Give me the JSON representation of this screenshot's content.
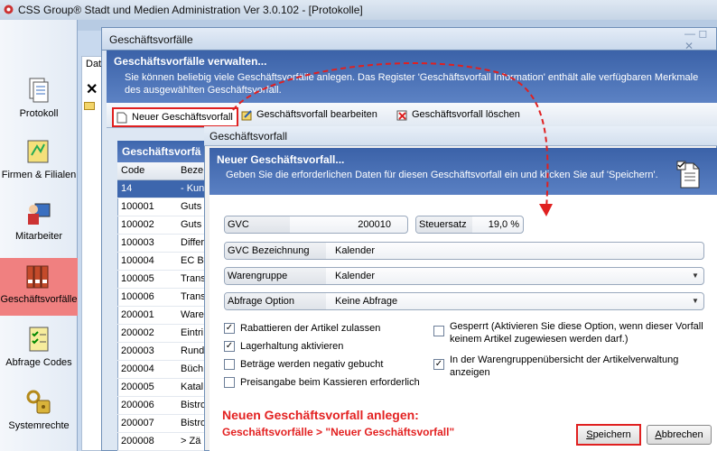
{
  "app": {
    "title": "CSS Group® Stadt und Medien Administration Ver 3.0.102 - [Protokolle]"
  },
  "nav": {
    "items": [
      {
        "label": "Protokoll",
        "icon": "protocol-icon"
      },
      {
        "label": "Firmen & Filialen",
        "icon": "companies-icon"
      },
      {
        "label": "Mitarbeiter",
        "icon": "employee-icon"
      },
      {
        "label": "Geschäftsvorfälle",
        "icon": "binders-icon",
        "active": true
      },
      {
        "label": "Abfrage Codes",
        "icon": "checklist-icon"
      },
      {
        "label": "Systemrechte",
        "icon": "keys-lock-icon"
      }
    ]
  },
  "back_window": {
    "partial_tab": "Dat"
  },
  "gv_window": {
    "title": "Geschäftsvorfälle",
    "header_title": "Geschäftsvorfälle verwalten...",
    "header_desc": "Sie können beliebig viele Geschäftsvorfälle anlegen. Das Register 'Geschäftsvorfall Information' enthält alle verfügbaren Merkmale des ausgewählten Geschäftsvorfall.",
    "toolbar": {
      "new": "Neuer Geschäftsvorfall",
      "edit": "Geschäftsvorfall bearbeiten",
      "delete": "Geschäftsvorfall löschen"
    },
    "grid": {
      "title": "Geschäftsvorfä",
      "columns": [
        "Code",
        "Beze"
      ],
      "rows": [
        {
          "code": "14",
          "name": "- Kun",
          "selected": true
        },
        {
          "code": "100001",
          "name": "Guts"
        },
        {
          "code": "100002",
          "name": "Guts"
        },
        {
          "code": "100003",
          "name": "Differ"
        },
        {
          "code": "100004",
          "name": "EC B"
        },
        {
          "code": "100005",
          "name": "Trans"
        },
        {
          "code": "100006",
          "name": "Trans"
        },
        {
          "code": "200001",
          "name": "Ware"
        },
        {
          "code": "200002",
          "name": "Eintri"
        },
        {
          "code": "200003",
          "name": "Rund"
        },
        {
          "code": "200004",
          "name": "Büch"
        },
        {
          "code": "200005",
          "name": "Katal"
        },
        {
          "code": "200006",
          "name": "Bistro"
        },
        {
          "code": "200007",
          "name": "Bistro"
        },
        {
          "code": "200008",
          "name": "> Zä"
        }
      ]
    }
  },
  "dialog": {
    "title": "Geschäftsvorfall",
    "header_title": "Neuer Geschäftsvorfall...",
    "header_desc": "Geben Sie die erforderlichen Daten für diesen Geschäftsvorfall ein und klicken Sie auf 'Speichern'.",
    "fields": {
      "gvc": {
        "label": "GVC",
        "value": "200010"
      },
      "steuersatz": {
        "label": "Steuersatz",
        "value": "19,0 %"
      },
      "bezeichnung": {
        "label": "GVC Bezeichnung",
        "value": "Kalender"
      },
      "warengruppe": {
        "label": "Warengruppe",
        "value": "Kalender"
      },
      "abfrage": {
        "label": "Abfrage Option",
        "value": "Keine Abfrage"
      }
    },
    "checkboxes": {
      "rabattieren": {
        "label": "Rabattieren der Artikel zulassen",
        "checked": true
      },
      "lagerhaltung": {
        "label": "Lagerhaltung aktivieren",
        "checked": true
      },
      "negativ": {
        "label": "Beträge werden negativ gebucht",
        "checked": false
      },
      "preisangabe": {
        "label": "Preisangabe beim Kassieren erforderlich",
        "checked": false
      },
      "gesperrt": {
        "label1": "Gesperrt (Aktivieren Sie diese Option, wenn dieser Vorfall",
        "label2": "keinem Artikel zugewiesen werden darf.)",
        "checked": false
      },
      "warengruppenuebersicht": {
        "label1": "In der Warengruppenübersicht der Artikelverwaltung",
        "label2": "anzeigen",
        "checked": true
      }
    },
    "note": {
      "title": "Neuen Geschäftsvorfall anlegen:",
      "path": "Geschäftsvorfälle > \"Neuer Geschäftsvorfall\""
    },
    "buttons": {
      "save_underlined": "S",
      "save_rest": "peichern",
      "cancel_underlined": "A",
      "cancel_rest": "bbrechen"
    }
  },
  "colors": {
    "accent": "#e02020",
    "header_blue": "#3b62a8",
    "nav_active": "#f08080"
  }
}
